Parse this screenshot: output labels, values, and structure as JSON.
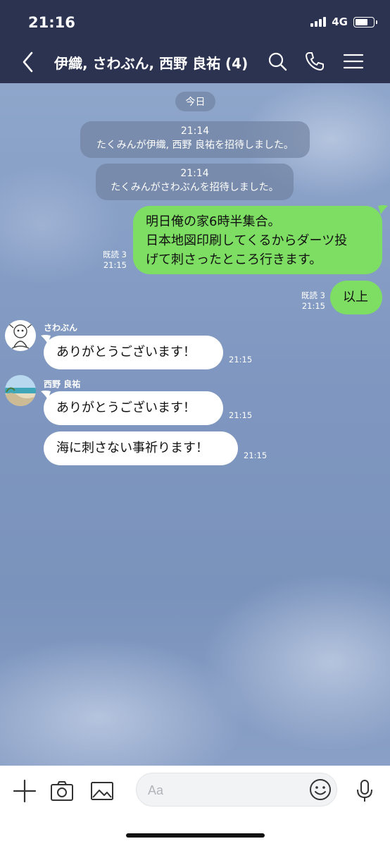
{
  "status": {
    "time": "21:16",
    "network": "4G"
  },
  "header": {
    "title": "伊織, さわぶん, 西野 良祐 (4)"
  },
  "chat": {
    "date_label": "今日",
    "system": [
      {
        "time": "21:14",
        "text": "たくみんが伊織, 西野 良祐を招待しました。"
      },
      {
        "time": "21:14",
        "text": "たくみんがさわぶんを招待しました。"
      }
    ],
    "outgoing": [
      {
        "lines": [
          "明日俺の家6時半集合。",
          "日本地図印刷してくるからダーツ投",
          "げて刺さったところ行きます。"
        ],
        "read": "既読 3",
        "time": "21:15"
      },
      {
        "lines": [
          "以上"
        ],
        "read": "既読 3",
        "time": "21:15"
      }
    ],
    "incoming": [
      {
        "sender": "さわぶん",
        "text": "ありがとうございます！",
        "time": "21:15"
      },
      {
        "sender": "西野 良祐",
        "text": "ありがとうございます！",
        "time": "21:15"
      },
      {
        "sender": "",
        "text": "海に刺さない事祈ります！",
        "time": "21:15"
      }
    ]
  },
  "composer": {
    "placeholder": "Aa"
  },
  "icons": {
    "back": "chevron-left-icon",
    "search": "search-icon",
    "call": "phone-icon",
    "menu": "menu-icon",
    "plus": "plus-icon",
    "camera": "camera-icon",
    "image": "image-icon",
    "emoji": "emoji-icon",
    "mic": "microphone-icon"
  },
  "colors": {
    "header": "#2b3350",
    "mine_bubble": "#7ede63",
    "theirs_bubble": "#ffffff",
    "chat_bg": "#8ea4c8"
  }
}
